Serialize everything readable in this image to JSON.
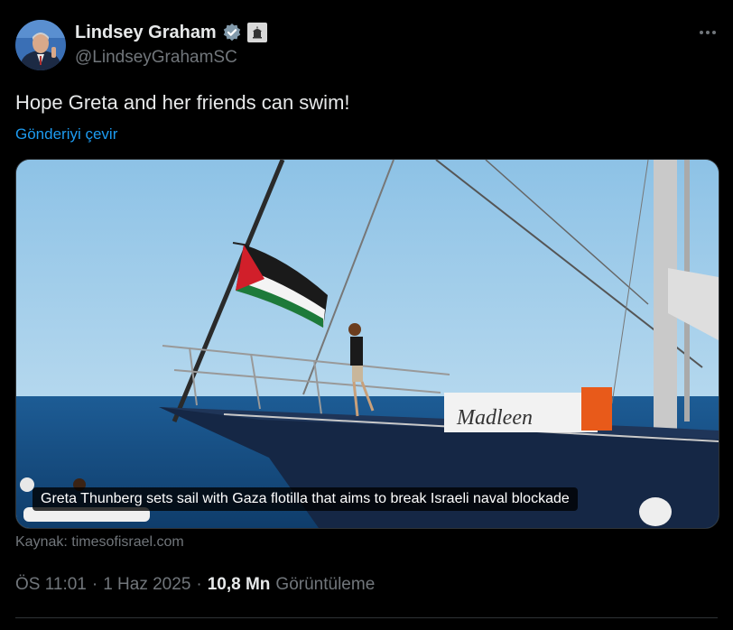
{
  "author": {
    "name": "Lindsey Graham",
    "handle": "@LindseyGrahamSC",
    "verified_icon": "verified-badge-icon",
    "affiliation_icon": "government-building-icon"
  },
  "tweet": {
    "text": "Hope Greta and her friends can swim!",
    "translate_label": "Gönderiyi çevir"
  },
  "media": {
    "caption": "Greta Thunberg sets sail with Gaza flotilla that aims to break Israeli naval blockade",
    "boat_name": "Madleen"
  },
  "source": {
    "label": "Kaynak: timesofisrael.com"
  },
  "meta": {
    "time": "ÖS 11:01",
    "separator1": "·",
    "date": "1 Haz 2025",
    "separator2": "·",
    "views_count": "10,8 Mn",
    "views_label": "Görüntüleme"
  },
  "colors": {
    "background": "#000000",
    "text_primary": "#e7e9ea",
    "text_secondary": "#71767b",
    "link": "#1d9bf0",
    "border": "#2f3336"
  }
}
